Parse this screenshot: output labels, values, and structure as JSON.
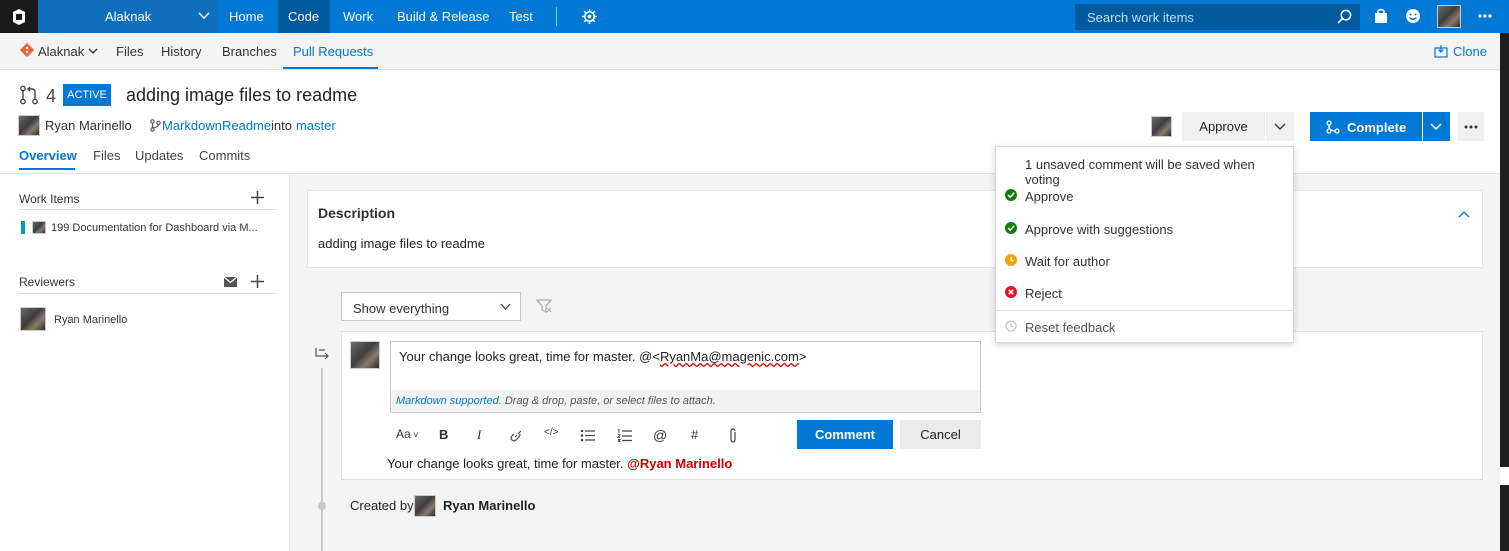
{
  "topbar": {
    "project": "Alaknak",
    "nav": [
      "Home",
      "Code",
      "Work",
      "Build & Release",
      "Test"
    ],
    "search_placeholder": "Search work items"
  },
  "subbar": {
    "repo": "Alaknak",
    "tabs": [
      "Files",
      "History",
      "Branches",
      "Pull Requests"
    ],
    "clone_label": "Clone"
  },
  "pr": {
    "id": "4",
    "status": "ACTIVE",
    "title": "adding image files to readme",
    "author": "Ryan Marinello",
    "source_branch": "MarkdownReadme",
    "into_word": "into",
    "target_branch": "master",
    "tabs": [
      "Overview",
      "Files",
      "Updates",
      "Commits"
    ]
  },
  "actions": {
    "approve_label": "Approve",
    "complete_label": "Complete"
  },
  "sidebar": {
    "work_items_title": "Work Items",
    "work_item": "199 Documentation for Dashboard via M...",
    "reviewers_title": "Reviewers",
    "reviewer": "Ryan Marinello"
  },
  "description": {
    "title": "Description",
    "body": "adding image files to readme"
  },
  "filter": {
    "value": "Show everything"
  },
  "comment": {
    "text_prefix": "Your change looks great, time for master. @<",
    "text_mention": "RyanMa@magenic.com",
    "text_suffix": ">",
    "hint_link": "Markdown supported.",
    "hint_rest": " Drag & drop, paste, or select files to attach.",
    "toolbar_font": "Aa",
    "comment_button": "Comment",
    "cancel_button": "Cancel",
    "preview_text": "Your change looks great, time for master. ",
    "preview_mention": "@Ryan Marinello",
    "created_by_label": "Created by",
    "created_by_name": "Ryan Marinello"
  },
  "vote_menu": {
    "notice": "1 unsaved comment will be saved when voting",
    "items": [
      {
        "label": "Approve",
        "color": "#107c10"
      },
      {
        "label": "Approve with suggestions",
        "color": "#107c10"
      },
      {
        "label": "Wait for author",
        "color": "#f0a30a"
      },
      {
        "label": "Reject",
        "color": "#e81123"
      }
    ],
    "reset": "Reset feedback"
  },
  "colors": {
    "brand": "#0078d4",
    "mention": "#cc0000"
  }
}
